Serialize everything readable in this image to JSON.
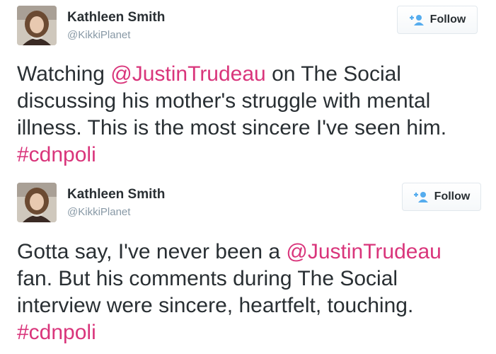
{
  "colors": {
    "link": "#d9357b",
    "follow_icon": "#55acee",
    "text": "#292f33",
    "muted": "#8899a6"
  },
  "tweets": [
    {
      "user": {
        "name": "Kathleen Smith",
        "handle": "@KikkiPlanet"
      },
      "follow_label": "Follow",
      "follow_icon": "add-user-icon",
      "parts": {
        "p1": "Watching ",
        "mention": "@JustinTrudeau",
        "p2": " on The Social discussing his mother's struggle with mental illness. This is the most sincere I've seen him. ",
        "hashtag": "#cdnpoli"
      }
    },
    {
      "user": {
        "name": "Kathleen Smith",
        "handle": "@KikkiPlanet"
      },
      "follow_label": "Follow",
      "follow_icon": "add-user-icon",
      "parts": {
        "p1": "Gotta say, I've never been a ",
        "mention": "@JustinTrudeau",
        "p2": " fan. But his comments during The Social interview were sincere, heartfelt, touching. ",
        "hashtag": "#cdnpoli"
      }
    }
  ]
}
